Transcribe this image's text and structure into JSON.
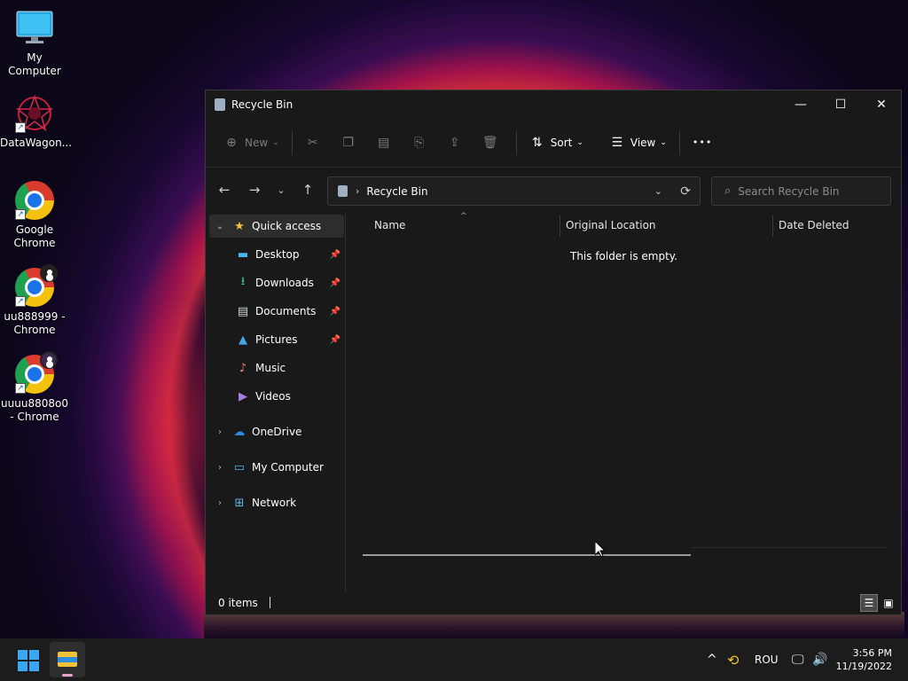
{
  "desktop": {
    "icons": [
      {
        "label": "My Computer",
        "icon": "monitor-icon"
      },
      {
        "label": "DataWagon...",
        "icon": "datawagon-icon"
      },
      {
        "label": "Google Chrome",
        "icon": "chrome-icon"
      },
      {
        "label": "uu888999 - Chrome",
        "icon": "chrome-profile-icon"
      },
      {
        "label": "uuuu8808o0 - Chrome",
        "icon": "chrome-profile-icon"
      }
    ]
  },
  "window": {
    "title": "Recycle Bin",
    "controls": {
      "minimize": "—",
      "maximize": "☐",
      "close": "✕"
    },
    "toolbar": {
      "new_label": "New",
      "sort_label": "Sort",
      "view_label": "View",
      "more_label": "•••"
    },
    "address": {
      "path": "Recycle Bin",
      "chevron": "›",
      "dropdown": "⌄",
      "refresh": "⟳"
    },
    "search": {
      "placeholder": "Search Recycle Bin"
    },
    "sidebar": {
      "quick_access": "Quick access",
      "items": [
        {
          "label": "Desktop",
          "pinned": true
        },
        {
          "label": "Downloads",
          "pinned": true
        },
        {
          "label": "Documents",
          "pinned": true
        },
        {
          "label": "Pictures",
          "pinned": true
        },
        {
          "label": "Music",
          "pinned": false
        },
        {
          "label": "Videos",
          "pinned": false
        }
      ],
      "onedrive": "OneDrive",
      "my_computer": "My Computer",
      "network": "Network"
    },
    "columns": {
      "name": "Name",
      "location": "Original Location",
      "deleted": "Date Deleted"
    },
    "empty_message": "This folder is empty.",
    "status": {
      "count": "0 items"
    }
  },
  "taskbar": {
    "tray": {
      "language": "ROU",
      "chevron": "^"
    },
    "clock": {
      "time": "3:56 PM",
      "date": "11/19/2022"
    }
  },
  "colors": {
    "accent": "#3aa7f5",
    "window_bg": "#191919",
    "taskbar_bg": "#1c1c1c"
  }
}
